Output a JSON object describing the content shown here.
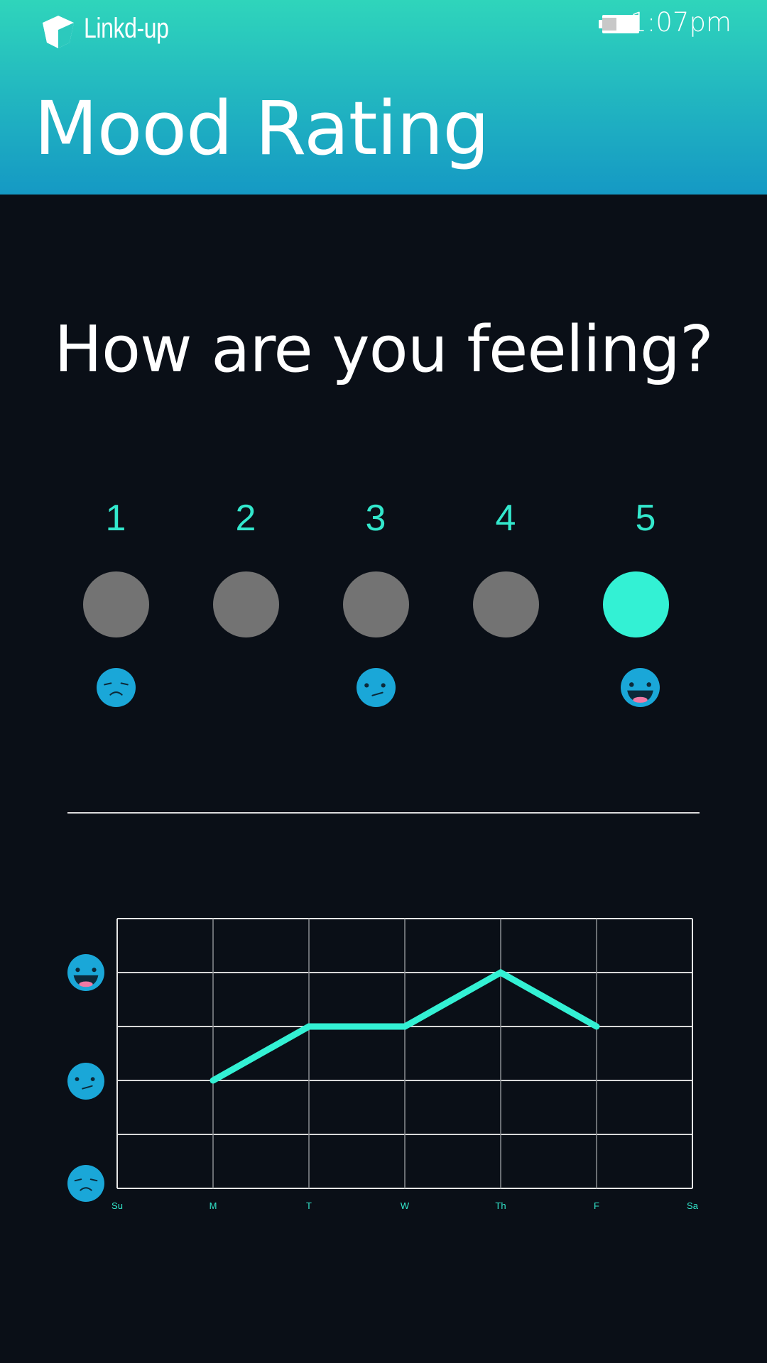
{
  "header": {
    "brand": "Linkd-up",
    "time": "1:07pm",
    "title": "Mood Rating"
  },
  "question": "How are you feeling?",
  "rating": {
    "options": [
      "1",
      "2",
      "3",
      "4",
      "5"
    ],
    "selected": "5",
    "face_icons": [
      "sad-face-icon",
      "neutral-face-icon",
      "happy-face-icon"
    ]
  },
  "colors": {
    "accent": "#33f1d4",
    "unselected": "#737373",
    "face": "#1aa7d8",
    "background": "#0a0f17"
  },
  "chart_data": {
    "type": "line",
    "categories": [
      "Su",
      "M",
      "T",
      "W",
      "Th",
      "F",
      "Sa"
    ],
    "values": [
      null,
      2,
      3,
      3,
      4,
      3,
      null
    ],
    "ylim": [
      0,
      5
    ],
    "y_axis_icons": [
      "happy-face-icon",
      "neutral-face-icon",
      "sad-face-icon"
    ],
    "grid": true
  }
}
